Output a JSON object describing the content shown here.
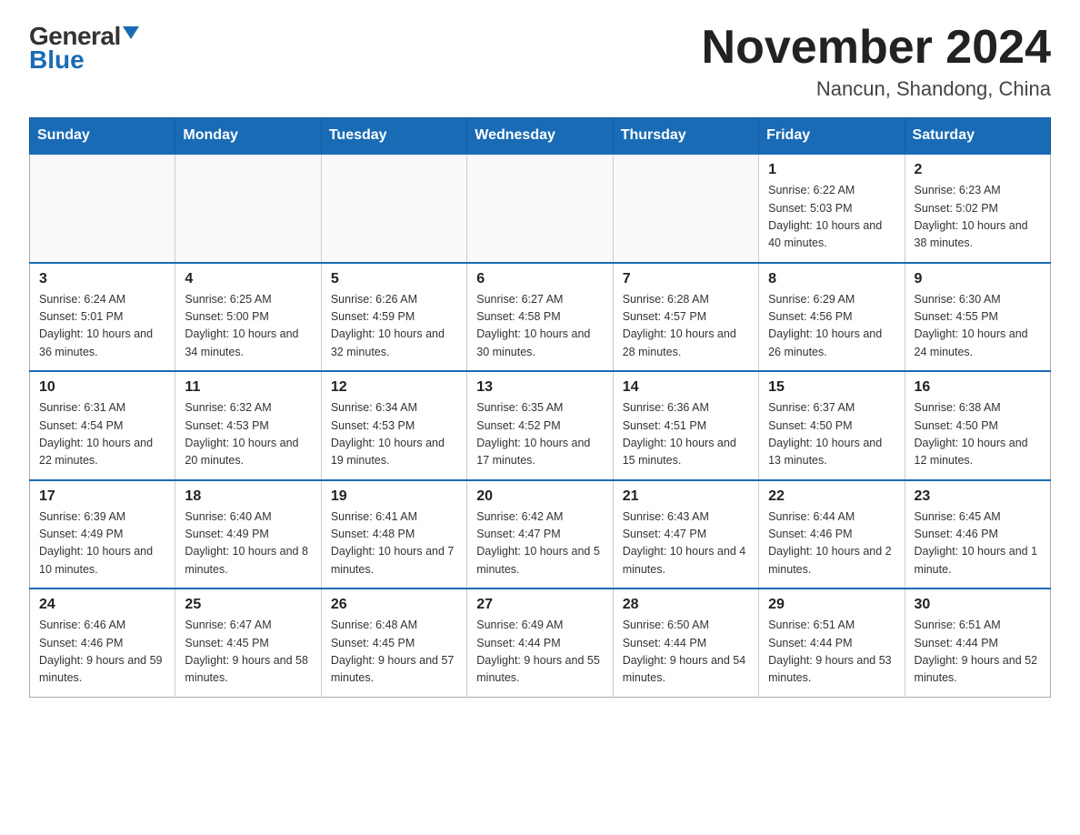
{
  "logo": {
    "general": "General",
    "blue": "Blue"
  },
  "title": {
    "month_year": "November 2024",
    "location": "Nancun, Shandong, China"
  },
  "days_of_week": [
    "Sunday",
    "Monday",
    "Tuesday",
    "Wednesday",
    "Thursday",
    "Friday",
    "Saturday"
  ],
  "weeks": [
    [
      {
        "day": "",
        "info": ""
      },
      {
        "day": "",
        "info": ""
      },
      {
        "day": "",
        "info": ""
      },
      {
        "day": "",
        "info": ""
      },
      {
        "day": "",
        "info": ""
      },
      {
        "day": "1",
        "info": "Sunrise: 6:22 AM\nSunset: 5:03 PM\nDaylight: 10 hours and 40 minutes."
      },
      {
        "day": "2",
        "info": "Sunrise: 6:23 AM\nSunset: 5:02 PM\nDaylight: 10 hours and 38 minutes."
      }
    ],
    [
      {
        "day": "3",
        "info": "Sunrise: 6:24 AM\nSunset: 5:01 PM\nDaylight: 10 hours and 36 minutes."
      },
      {
        "day": "4",
        "info": "Sunrise: 6:25 AM\nSunset: 5:00 PM\nDaylight: 10 hours and 34 minutes."
      },
      {
        "day": "5",
        "info": "Sunrise: 6:26 AM\nSunset: 4:59 PM\nDaylight: 10 hours and 32 minutes."
      },
      {
        "day": "6",
        "info": "Sunrise: 6:27 AM\nSunset: 4:58 PM\nDaylight: 10 hours and 30 minutes."
      },
      {
        "day": "7",
        "info": "Sunrise: 6:28 AM\nSunset: 4:57 PM\nDaylight: 10 hours and 28 minutes."
      },
      {
        "day": "8",
        "info": "Sunrise: 6:29 AM\nSunset: 4:56 PM\nDaylight: 10 hours and 26 minutes."
      },
      {
        "day": "9",
        "info": "Sunrise: 6:30 AM\nSunset: 4:55 PM\nDaylight: 10 hours and 24 minutes."
      }
    ],
    [
      {
        "day": "10",
        "info": "Sunrise: 6:31 AM\nSunset: 4:54 PM\nDaylight: 10 hours and 22 minutes."
      },
      {
        "day": "11",
        "info": "Sunrise: 6:32 AM\nSunset: 4:53 PM\nDaylight: 10 hours and 20 minutes."
      },
      {
        "day": "12",
        "info": "Sunrise: 6:34 AM\nSunset: 4:53 PM\nDaylight: 10 hours and 19 minutes."
      },
      {
        "day": "13",
        "info": "Sunrise: 6:35 AM\nSunset: 4:52 PM\nDaylight: 10 hours and 17 minutes."
      },
      {
        "day": "14",
        "info": "Sunrise: 6:36 AM\nSunset: 4:51 PM\nDaylight: 10 hours and 15 minutes."
      },
      {
        "day": "15",
        "info": "Sunrise: 6:37 AM\nSunset: 4:50 PM\nDaylight: 10 hours and 13 minutes."
      },
      {
        "day": "16",
        "info": "Sunrise: 6:38 AM\nSunset: 4:50 PM\nDaylight: 10 hours and 12 minutes."
      }
    ],
    [
      {
        "day": "17",
        "info": "Sunrise: 6:39 AM\nSunset: 4:49 PM\nDaylight: 10 hours and 10 minutes."
      },
      {
        "day": "18",
        "info": "Sunrise: 6:40 AM\nSunset: 4:49 PM\nDaylight: 10 hours and 8 minutes."
      },
      {
        "day": "19",
        "info": "Sunrise: 6:41 AM\nSunset: 4:48 PM\nDaylight: 10 hours and 7 minutes."
      },
      {
        "day": "20",
        "info": "Sunrise: 6:42 AM\nSunset: 4:47 PM\nDaylight: 10 hours and 5 minutes."
      },
      {
        "day": "21",
        "info": "Sunrise: 6:43 AM\nSunset: 4:47 PM\nDaylight: 10 hours and 4 minutes."
      },
      {
        "day": "22",
        "info": "Sunrise: 6:44 AM\nSunset: 4:46 PM\nDaylight: 10 hours and 2 minutes."
      },
      {
        "day": "23",
        "info": "Sunrise: 6:45 AM\nSunset: 4:46 PM\nDaylight: 10 hours and 1 minute."
      }
    ],
    [
      {
        "day": "24",
        "info": "Sunrise: 6:46 AM\nSunset: 4:46 PM\nDaylight: 9 hours and 59 minutes."
      },
      {
        "day": "25",
        "info": "Sunrise: 6:47 AM\nSunset: 4:45 PM\nDaylight: 9 hours and 58 minutes."
      },
      {
        "day": "26",
        "info": "Sunrise: 6:48 AM\nSunset: 4:45 PM\nDaylight: 9 hours and 57 minutes."
      },
      {
        "day": "27",
        "info": "Sunrise: 6:49 AM\nSunset: 4:44 PM\nDaylight: 9 hours and 55 minutes."
      },
      {
        "day": "28",
        "info": "Sunrise: 6:50 AM\nSunset: 4:44 PM\nDaylight: 9 hours and 54 minutes."
      },
      {
        "day": "29",
        "info": "Sunrise: 6:51 AM\nSunset: 4:44 PM\nDaylight: 9 hours and 53 minutes."
      },
      {
        "day": "30",
        "info": "Sunrise: 6:51 AM\nSunset: 4:44 PM\nDaylight: 9 hours and 52 minutes."
      }
    ]
  ]
}
